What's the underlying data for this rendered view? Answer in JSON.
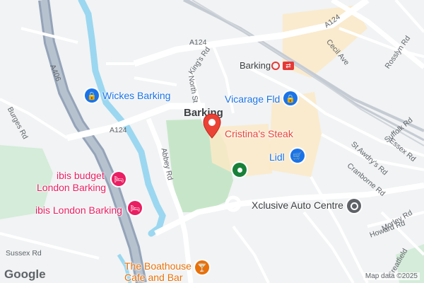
{
  "map": {
    "town_label": "Barking",
    "roads": {
      "a406": "A406",
      "a124_west": "A124",
      "a124_north": "A124",
      "a124_ne": "A124",
      "kings_rd": "King's Rd",
      "north_st": "North St",
      "abbey_rd": "Abbey Rd",
      "burges_rd": "Burges Rd",
      "sussex_rd": "Sussex Rd",
      "cecil_ave": "Cecil Ave",
      "rosslyn_rd": "Rosslyn Rd",
      "suffolk_rd": "Suffolk Rd",
      "essex_rd": "Essex Rd",
      "st_awdrys_rd": "St Awdry's Rd",
      "cranborne_rd": "Cranborne Rd",
      "morley_rd": "Morley Rd",
      "howard_rd": "Howard Rd",
      "greatfield": "Greatfield"
    },
    "station": {
      "label": "Barking"
    },
    "places": [
      {
        "id": "wickes",
        "label": "Wickes Barking",
        "icon": "shopping-bag-icon",
        "color": "#1a73e8"
      },
      {
        "id": "vicarage",
        "label": "Vicarage Fld",
        "icon": "shopping-bag-icon",
        "color": "#1a73e8"
      },
      {
        "id": "cristinas",
        "label": "Cristina's Steak",
        "icon": "restaurant-pin-icon",
        "color": "#ea4335"
      },
      {
        "id": "lidl",
        "label": "Lidl",
        "icon": "shopping-cart-icon",
        "color": "#1a73e8"
      },
      {
        "id": "ibis_budget",
        "label_line1": "ibis budget",
        "label_line2": "London Barking",
        "icon": "hotel-icon",
        "color": "#e91e63"
      },
      {
        "id": "ibis",
        "label": "ibis London Barking",
        "icon": "hotel-icon",
        "color": "#e91e63"
      },
      {
        "id": "xclusive",
        "label": "Xclusive Auto Centre",
        "icon": "auto-service-icon",
        "color": "#3c4043"
      },
      {
        "id": "boathouse",
        "label_line1": "The Boathouse",
        "label_line2": "Cafe and Bar",
        "icon": "bar-icon",
        "color": "#e8710a"
      },
      {
        "id": "park",
        "icon": "park-icon",
        "color": "#188038"
      }
    ],
    "attribution": "Map data ©2025",
    "brand": "Google"
  }
}
